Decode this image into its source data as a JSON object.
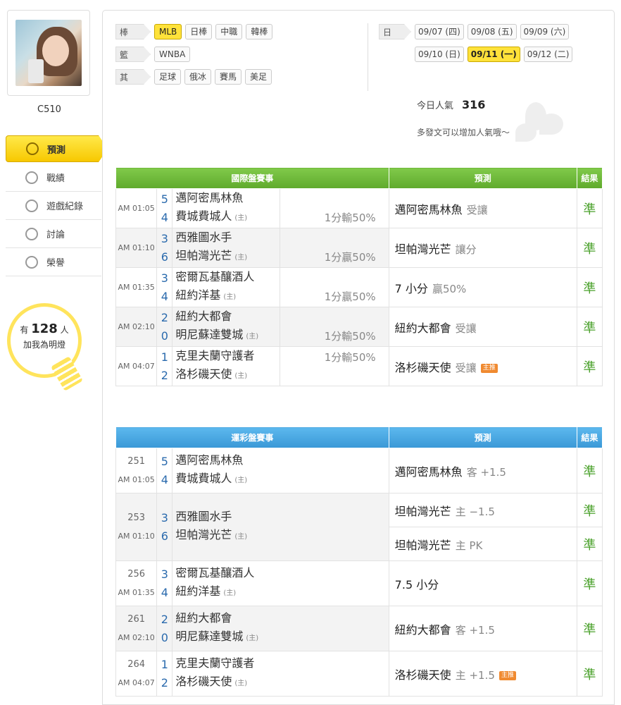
{
  "sidebar": {
    "username": "C510",
    "nav": [
      {
        "label": "預測",
        "icon": "target-icon"
      },
      {
        "label": "戰績",
        "icon": "medal-icon"
      },
      {
        "label": "遊戲紀錄",
        "icon": "record-icon"
      },
      {
        "label": "討論",
        "icon": "discuss-icon"
      },
      {
        "label": "榮譽",
        "icon": "honor-icon"
      }
    ],
    "bulb": {
      "prefix": "有",
      "count": "128",
      "suffix": "人",
      "text": "加我為明燈"
    }
  },
  "filters": {
    "baseball": {
      "label": "棒球",
      "tags": [
        "MLB",
        "日棒",
        "中職",
        "韓棒"
      ]
    },
    "basketball": {
      "label": "籃球",
      "tags": [
        "WNBA"
      ]
    },
    "other": {
      "label": "其他",
      "tags": [
        "足球",
        "俄冰",
        "賽馬",
        "美足"
      ]
    }
  },
  "dates": {
    "label": "日期",
    "row1": [
      "09/07 (四)",
      "09/08 (五)",
      "09/09 (六)"
    ],
    "row2": [
      "09/10 (日)",
      "09/11 (一)",
      "09/12 (二)"
    ]
  },
  "popularity": {
    "label": "今日人氣",
    "value": "316",
    "hint": "多發文可以增加人氣哦～"
  },
  "intl": {
    "headers": [
      "國際盤賽事",
      "預測",
      "結果"
    ],
    "games": [
      {
        "time": "AM 01:05",
        "away_score": "5",
        "away": "邁阿密馬林魚",
        "home_score": "4",
        "home": "費城費城人",
        "spread": "1分輸50%",
        "spread_row": 2,
        "pred": "邁阿密馬林魚",
        "pred_sub": "受讓",
        "result": "準"
      },
      {
        "time": "AM 01:10",
        "away_score": "3",
        "away": "西雅圖水手",
        "home_score": "6",
        "home": "坦帕灣光芒",
        "spread": "1分贏50%",
        "spread_row": 2,
        "pred": "坦帕灣光芒",
        "pred_sub": "讓分",
        "result": "準"
      },
      {
        "time": "AM 01:35",
        "away_score": "3",
        "away": "密爾瓦基釀酒人",
        "home_score": "4",
        "home": "紐約洋基",
        "spread": "1分贏50%",
        "spread_row": 2,
        "pred": "7 小分",
        "pred_sub": "贏50%",
        "result": "準"
      },
      {
        "time": "AM 02:10",
        "away_score": "2",
        "away": "紐約大都會",
        "home_score": "0",
        "home": "明尼蘇達雙城",
        "spread": "1分輸50%",
        "spread_row": 2,
        "pred": "紐約大都會",
        "pred_sub": "受讓",
        "result": "準"
      },
      {
        "time": "AM 04:07",
        "away_score": "1",
        "away": "克里夫蘭守護者",
        "home_score": "2",
        "home": "洛杉磯天使",
        "spread": "1分輸50%",
        "spread_row": 1,
        "pred": "洛杉磯天使",
        "pred_sub": "受讓",
        "badge": "主推",
        "result": "準"
      }
    ]
  },
  "lottery": {
    "headers": [
      "運彩盤賽事",
      "預測",
      "結果"
    ],
    "home_tag": "(主)",
    "games": [
      {
        "num": "251",
        "time": "AM 01:05",
        "away_score": "5",
        "away": "邁阿密馬林魚",
        "home_score": "4",
        "home": "費城費城人",
        "preds": [
          {
            "text": "邁阿密馬林魚",
            "sub": "客 +1.5",
            "result": "準"
          }
        ]
      },
      {
        "num": "253",
        "time": "AM 01:10",
        "away_score": "3",
        "away": "西雅圖水手",
        "home_score": "6",
        "home": "坦帕灣光芒",
        "preds": [
          {
            "text": "坦帕灣光芒",
            "sub": "主 −1.5",
            "result": "準"
          },
          {
            "text": "坦帕灣光芒",
            "sub": "主 PK",
            "result": "準"
          }
        ]
      },
      {
        "num": "256",
        "time": "AM 01:35",
        "away_score": "3",
        "away": "密爾瓦基釀酒人",
        "home_score": "4",
        "home": "紐約洋基",
        "preds": [
          {
            "text": "7.5 小分",
            "sub": "",
            "result": "準"
          }
        ]
      },
      {
        "num": "261",
        "time": "AM 02:10",
        "away_score": "2",
        "away": "紐約大都會",
        "home_score": "0",
        "home": "明尼蘇達雙城",
        "preds": [
          {
            "text": "紐約大都會",
            "sub": "客 +1.5",
            "result": "準"
          }
        ]
      },
      {
        "num": "264",
        "time": "AM 04:07",
        "away_score": "1",
        "away": "克里夫蘭守護者",
        "home_score": "2",
        "home": "洛杉磯天使",
        "preds": [
          {
            "text": "洛杉磯天使",
            "sub": "主 +1.5",
            "badge": "主推",
            "result": "準"
          }
        ]
      }
    ]
  }
}
